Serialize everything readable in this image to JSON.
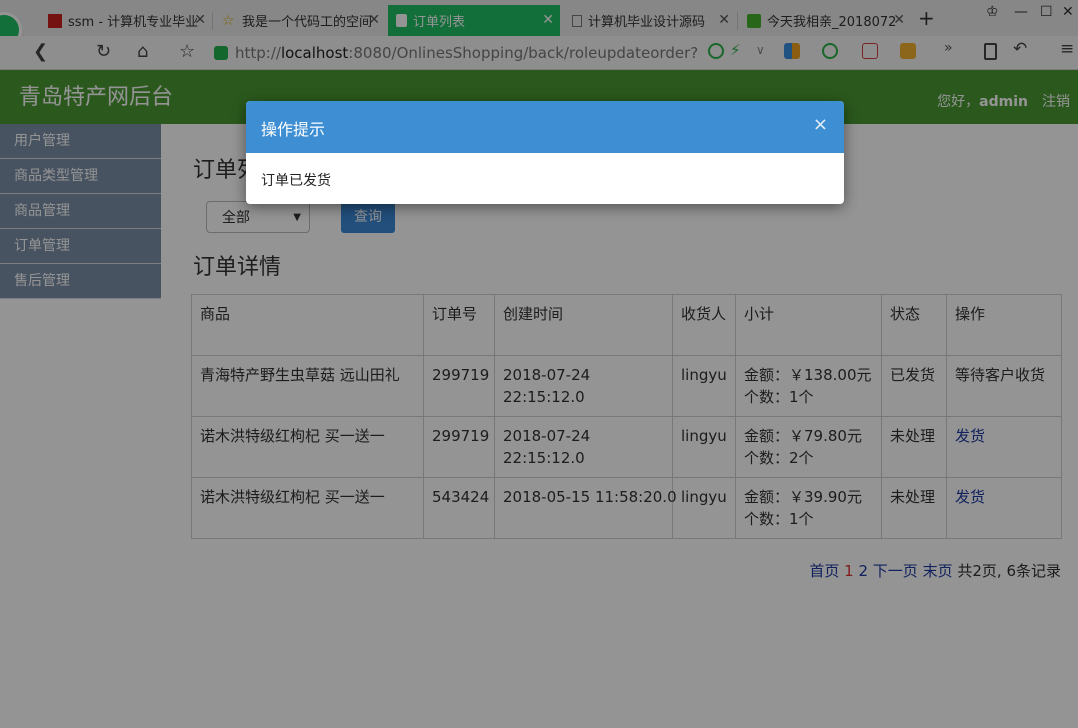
{
  "browser": {
    "tabs": [
      {
        "title": "ssm - 计算机专业毕业"
      },
      {
        "title": "我是一个代码工的空间"
      },
      {
        "title": "订单列表"
      },
      {
        "title": "计算机毕业设计源码"
      },
      {
        "title": "今天我相亲_2018072"
      }
    ],
    "url_prefix": "http://",
    "url_host": "localhost",
    "url_rest": ":8080/OnlinesShopping/back/roleupdateorder?"
  },
  "header": {
    "site_title": "青岛特产网后台",
    "greeting": "您好，",
    "username": "admin",
    "logout": "注销"
  },
  "sidebar": {
    "items": [
      {
        "label": "用户管理"
      },
      {
        "label": "商品类型管理"
      },
      {
        "label": "商品管理"
      },
      {
        "label": "订单管理"
      },
      {
        "label": "售后管理"
      }
    ]
  },
  "main": {
    "page_title": "订单列表",
    "filter_value": "全部",
    "query_label": "查询",
    "section_title": "订单详情"
  },
  "table": {
    "headers": [
      "商品",
      "订单号",
      "创建时间",
      "收货人",
      "小计",
      "状态",
      "操作"
    ],
    "rows": [
      {
        "product": "青海特产野生虫草菇  远山田礼",
        "order_no": "299719",
        "created": "2018-07-24 22:15:12.0",
        "receiver": "lingyu",
        "amount": "金额：￥138.00元",
        "count": "个数：1个",
        "status": "已发货",
        "action": "等待客户收货"
      },
      {
        "product": "诺木洪特级红枸杞  买一送一",
        "order_no": "299719",
        "created": "2018-07-24 22:15:12.0",
        "receiver": "lingyu",
        "amount": "金额：￥79.80元",
        "count": "个数：2个",
        "status": "未处理",
        "action": "发货"
      },
      {
        "product": "诺木洪特级红枸杞  买一送一",
        "order_no": "543424",
        "created": "2018-05-15 11:58:20.0",
        "receiver": "lingyu",
        "amount": "金额：￥39.90元",
        "count": "个数：1个",
        "status": "未处理",
        "action": "发货"
      }
    ]
  },
  "pager": {
    "first": "首页",
    "current": "1",
    "next_page_num": "2",
    "next": "下一页",
    "last": "末页",
    "summary": "共2页, 6条记录"
  },
  "modal": {
    "title": "操作提示",
    "close": "×",
    "message": "订单已发货"
  },
  "colors": {
    "header_green": "#4a9a33",
    "active_tab": "#1fbf64",
    "modal_header": "#3d8ed3",
    "sidebar": "#7a8fa7"
  }
}
